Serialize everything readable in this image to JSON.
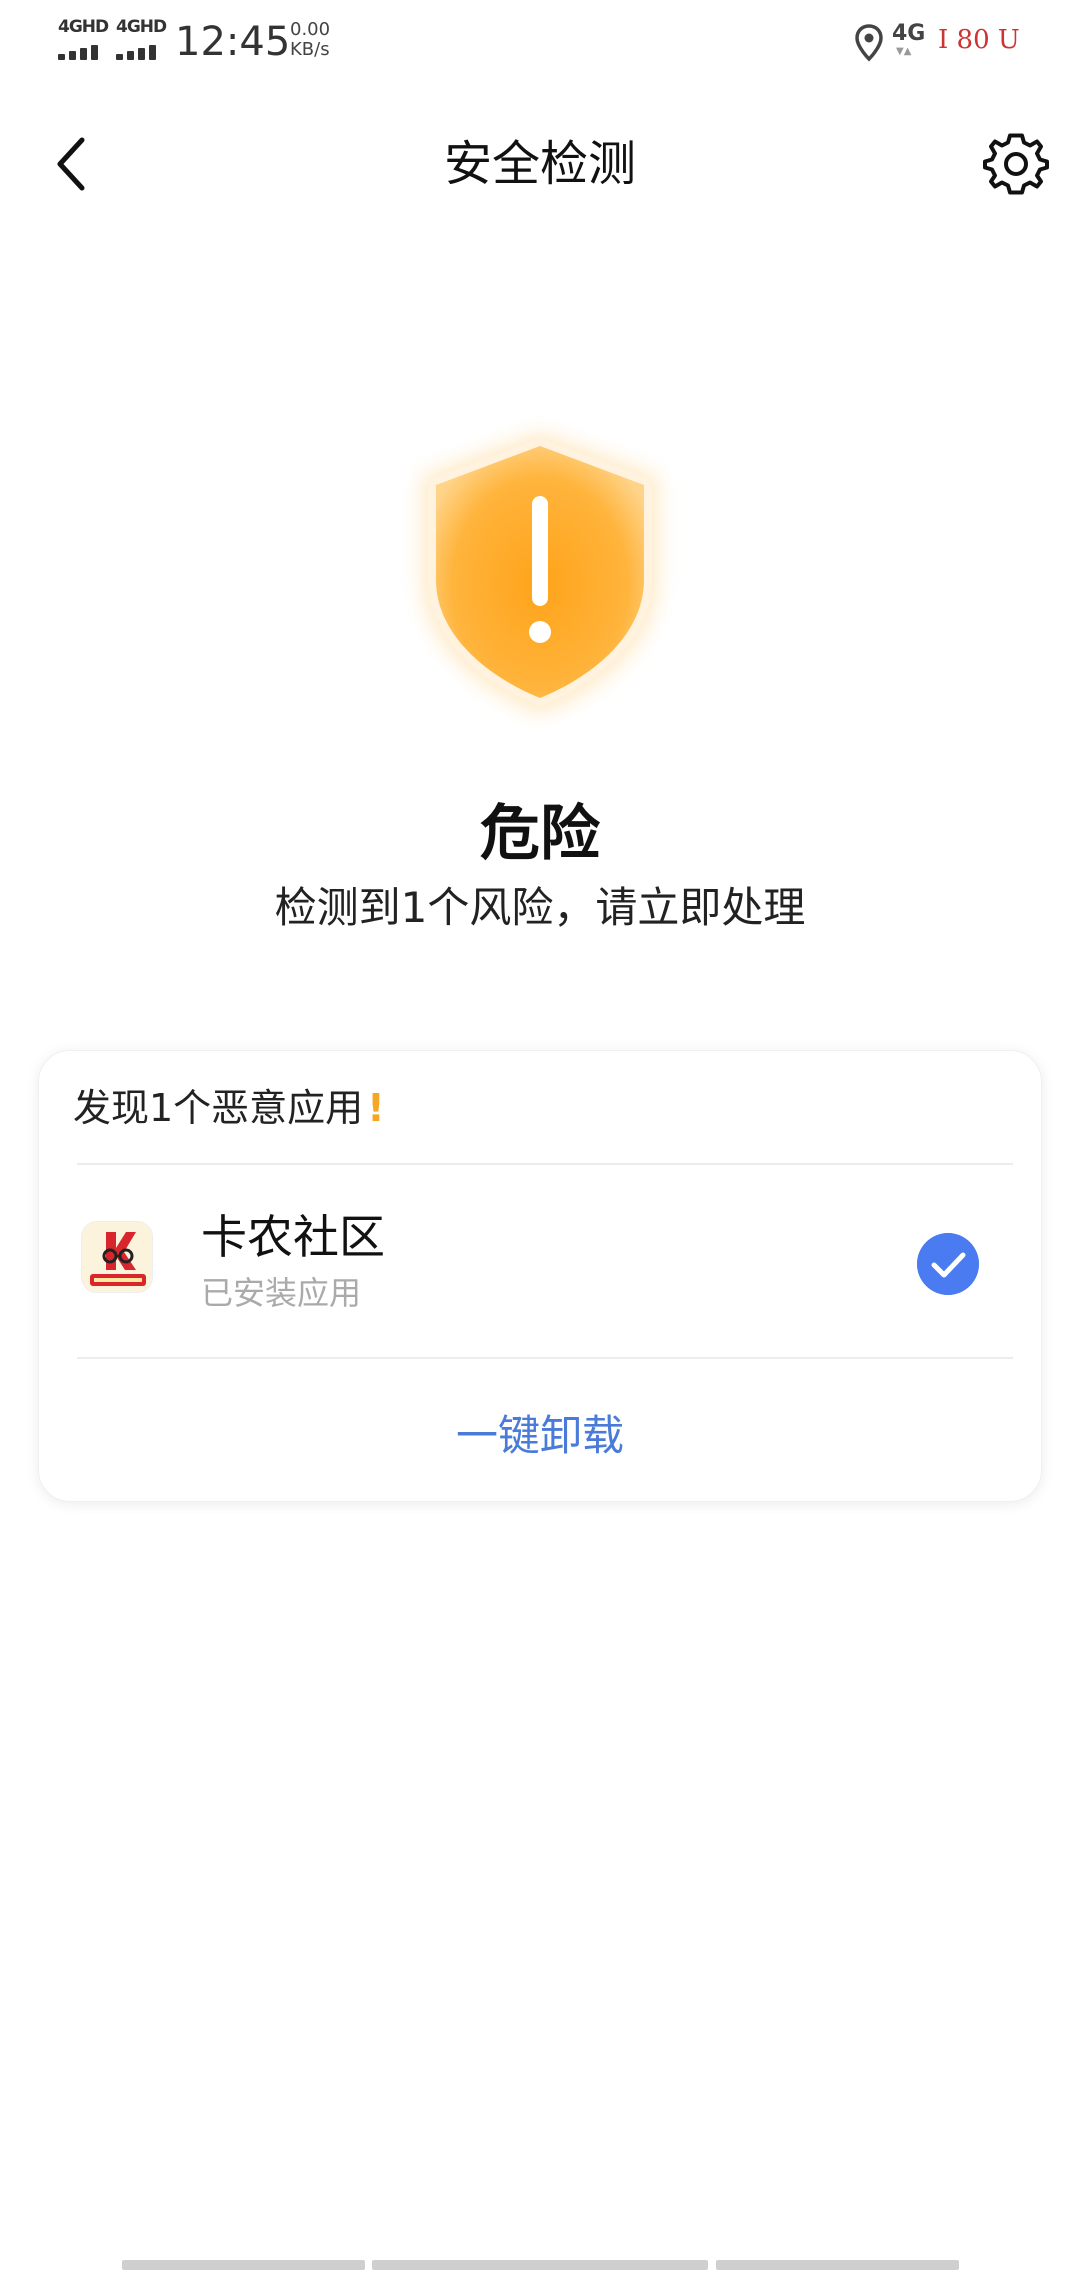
{
  "status_bar": {
    "sim1_label": "4GHD",
    "sim2_label": "4GHD",
    "time": "12:45",
    "net_speed_value": "0.00",
    "net_speed_unit": "KB/s",
    "network_type": "4G",
    "battery_text": "I 80 U"
  },
  "header": {
    "title": "安全检测"
  },
  "result": {
    "level": "危险",
    "description": "检测到1个风险，请立即处理",
    "level_color": "#f5a623"
  },
  "card": {
    "header": "发现1个恶意应用",
    "warn_mark": "!",
    "app": {
      "name": "卡农社区",
      "status": "已安装应用",
      "icon": "kanong-app-icon",
      "checked": true
    },
    "action_label": "一键卸载",
    "accent_color": "#4a7bf0"
  }
}
